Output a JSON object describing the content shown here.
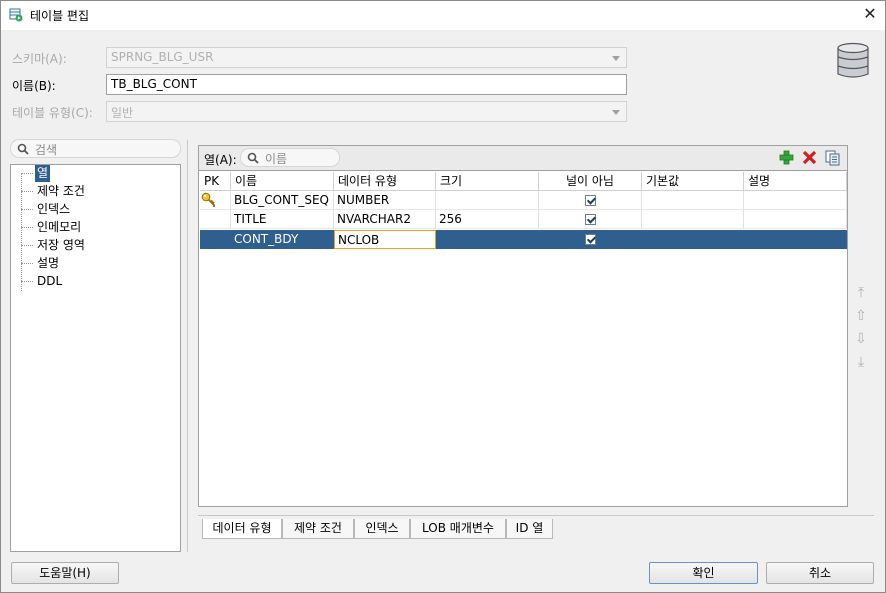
{
  "window": {
    "title": "테이블 편집"
  },
  "form": {
    "schema_label": "스키마(A):",
    "schema_value": "SPRNG_BLG_USR",
    "name_label": "이름(B):",
    "name_value": "TB_BLG_CONT",
    "table_type_label": "테이블 유형(C):",
    "table_type_value": "일반"
  },
  "nav": {
    "search_placeholder": "검색",
    "items": [
      "열",
      "제약 조건",
      "인덱스",
      "인메모리",
      "저장 영역",
      "설명",
      "DDL"
    ]
  },
  "columns_panel": {
    "label": "열(A):",
    "search_placeholder": "이름",
    "headers": [
      "PK",
      "이름",
      "데이터 유형",
      "크기",
      "널이 아님",
      "기본값",
      "설명"
    ],
    "rows": [
      {
        "pk": true,
        "name": "BLG_CONT_SEQ",
        "type": "NUMBER",
        "size": "",
        "not_null": true,
        "default": "",
        "desc": ""
      },
      {
        "pk": false,
        "name": "TITLE",
        "type": "NVARCHAR2",
        "size": "256",
        "not_null": true,
        "default": "",
        "desc": ""
      },
      {
        "pk": false,
        "name": "CONT_BDY",
        "type": "NCLOB",
        "size": "",
        "not_null": true,
        "default": "",
        "desc": ""
      }
    ],
    "selected_row": 2,
    "tabs": [
      "데이터 유형",
      "제약 조건",
      "인덱스",
      "LOB 매개변수",
      "ID 열"
    ]
  },
  "buttons": {
    "help": "도움말(H)",
    "ok": "확인",
    "cancel": "취소"
  },
  "colors": {
    "selection": "#2e5f8e",
    "add": "#3aa33a",
    "remove": "#d02020"
  }
}
